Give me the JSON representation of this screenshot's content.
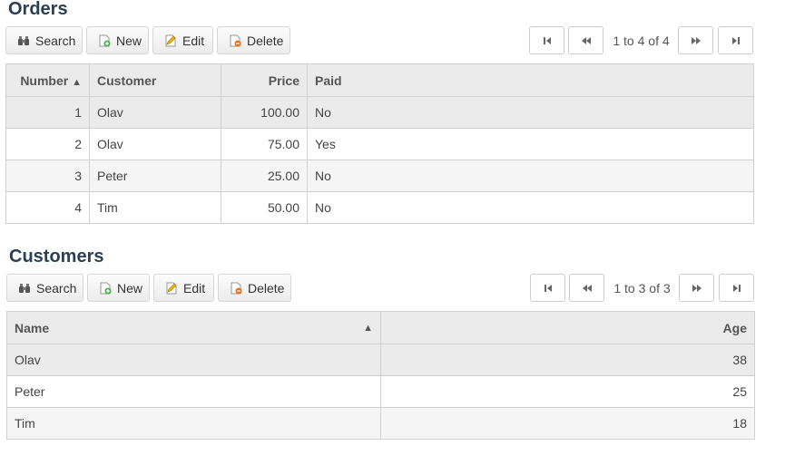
{
  "orders": {
    "title": "Orders",
    "toolbar": {
      "search": "Search",
      "new": "New",
      "edit": "Edit",
      "delete": "Delete"
    },
    "pager": {
      "info": "1 to 4 of 4"
    },
    "columns": {
      "number": "Number",
      "customer": "Customer",
      "price": "Price",
      "paid": "Paid"
    },
    "sort_indicator": "▲",
    "rows": [
      {
        "number": "1",
        "customer": "Olav",
        "price": "100.00",
        "paid": "No"
      },
      {
        "number": "2",
        "customer": "Olav",
        "price": "75.00",
        "paid": "Yes"
      },
      {
        "number": "3",
        "customer": "Peter",
        "price": "25.00",
        "paid": "No"
      },
      {
        "number": "4",
        "customer": "Tim",
        "price": "50.00",
        "paid": "No"
      }
    ]
  },
  "customers": {
    "title": "Customers",
    "toolbar": {
      "search": "Search",
      "new": "New",
      "edit": "Edit",
      "delete": "Delete"
    },
    "pager": {
      "info": "1 to 3 of 3"
    },
    "columns": {
      "name": "Name",
      "age": "Age"
    },
    "sort_indicator": "▲",
    "rows": [
      {
        "name": "Olav",
        "age": "38"
      },
      {
        "name": "Peter",
        "age": "25"
      },
      {
        "name": "Tim",
        "age": "18"
      }
    ]
  },
  "icons": {
    "search": "binoculars-icon",
    "new": "new-document-icon",
    "edit": "pencil-icon",
    "delete": "delete-document-icon",
    "first": "first-page-icon",
    "prev": "previous-page-icon",
    "next": "next-page-icon",
    "last": "last-page-icon"
  }
}
